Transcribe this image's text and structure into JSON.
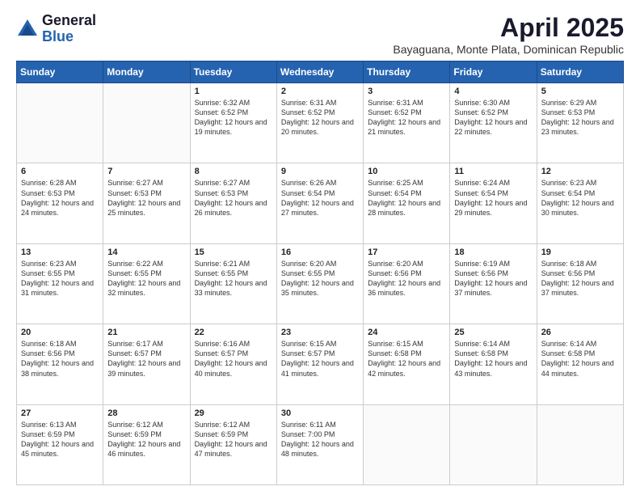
{
  "logo": {
    "general": "General",
    "blue": "Blue"
  },
  "header": {
    "month": "April 2025",
    "location": "Bayaguana, Monte Plata, Dominican Republic"
  },
  "days_of_week": [
    "Sunday",
    "Monday",
    "Tuesday",
    "Wednesday",
    "Thursday",
    "Friday",
    "Saturday"
  ],
  "weeks": [
    [
      {
        "day": "",
        "info": ""
      },
      {
        "day": "",
        "info": ""
      },
      {
        "day": "1",
        "info": "Sunrise: 6:32 AM\nSunset: 6:52 PM\nDaylight: 12 hours and 19 minutes."
      },
      {
        "day": "2",
        "info": "Sunrise: 6:31 AM\nSunset: 6:52 PM\nDaylight: 12 hours and 20 minutes."
      },
      {
        "day": "3",
        "info": "Sunrise: 6:31 AM\nSunset: 6:52 PM\nDaylight: 12 hours and 21 minutes."
      },
      {
        "day": "4",
        "info": "Sunrise: 6:30 AM\nSunset: 6:52 PM\nDaylight: 12 hours and 22 minutes."
      },
      {
        "day": "5",
        "info": "Sunrise: 6:29 AM\nSunset: 6:53 PM\nDaylight: 12 hours and 23 minutes."
      }
    ],
    [
      {
        "day": "6",
        "info": "Sunrise: 6:28 AM\nSunset: 6:53 PM\nDaylight: 12 hours and 24 minutes."
      },
      {
        "day": "7",
        "info": "Sunrise: 6:27 AM\nSunset: 6:53 PM\nDaylight: 12 hours and 25 minutes."
      },
      {
        "day": "8",
        "info": "Sunrise: 6:27 AM\nSunset: 6:53 PM\nDaylight: 12 hours and 26 minutes."
      },
      {
        "day": "9",
        "info": "Sunrise: 6:26 AM\nSunset: 6:54 PM\nDaylight: 12 hours and 27 minutes."
      },
      {
        "day": "10",
        "info": "Sunrise: 6:25 AM\nSunset: 6:54 PM\nDaylight: 12 hours and 28 minutes."
      },
      {
        "day": "11",
        "info": "Sunrise: 6:24 AM\nSunset: 6:54 PM\nDaylight: 12 hours and 29 minutes."
      },
      {
        "day": "12",
        "info": "Sunrise: 6:23 AM\nSunset: 6:54 PM\nDaylight: 12 hours and 30 minutes."
      }
    ],
    [
      {
        "day": "13",
        "info": "Sunrise: 6:23 AM\nSunset: 6:55 PM\nDaylight: 12 hours and 31 minutes."
      },
      {
        "day": "14",
        "info": "Sunrise: 6:22 AM\nSunset: 6:55 PM\nDaylight: 12 hours and 32 minutes."
      },
      {
        "day": "15",
        "info": "Sunrise: 6:21 AM\nSunset: 6:55 PM\nDaylight: 12 hours and 33 minutes."
      },
      {
        "day": "16",
        "info": "Sunrise: 6:20 AM\nSunset: 6:55 PM\nDaylight: 12 hours and 35 minutes."
      },
      {
        "day": "17",
        "info": "Sunrise: 6:20 AM\nSunset: 6:56 PM\nDaylight: 12 hours and 36 minutes."
      },
      {
        "day": "18",
        "info": "Sunrise: 6:19 AM\nSunset: 6:56 PM\nDaylight: 12 hours and 37 minutes."
      },
      {
        "day": "19",
        "info": "Sunrise: 6:18 AM\nSunset: 6:56 PM\nDaylight: 12 hours and 37 minutes."
      }
    ],
    [
      {
        "day": "20",
        "info": "Sunrise: 6:18 AM\nSunset: 6:56 PM\nDaylight: 12 hours and 38 minutes."
      },
      {
        "day": "21",
        "info": "Sunrise: 6:17 AM\nSunset: 6:57 PM\nDaylight: 12 hours and 39 minutes."
      },
      {
        "day": "22",
        "info": "Sunrise: 6:16 AM\nSunset: 6:57 PM\nDaylight: 12 hours and 40 minutes."
      },
      {
        "day": "23",
        "info": "Sunrise: 6:15 AM\nSunset: 6:57 PM\nDaylight: 12 hours and 41 minutes."
      },
      {
        "day": "24",
        "info": "Sunrise: 6:15 AM\nSunset: 6:58 PM\nDaylight: 12 hours and 42 minutes."
      },
      {
        "day": "25",
        "info": "Sunrise: 6:14 AM\nSunset: 6:58 PM\nDaylight: 12 hours and 43 minutes."
      },
      {
        "day": "26",
        "info": "Sunrise: 6:14 AM\nSunset: 6:58 PM\nDaylight: 12 hours and 44 minutes."
      }
    ],
    [
      {
        "day": "27",
        "info": "Sunrise: 6:13 AM\nSunset: 6:59 PM\nDaylight: 12 hours and 45 minutes."
      },
      {
        "day": "28",
        "info": "Sunrise: 6:12 AM\nSunset: 6:59 PM\nDaylight: 12 hours and 46 minutes."
      },
      {
        "day": "29",
        "info": "Sunrise: 6:12 AM\nSunset: 6:59 PM\nDaylight: 12 hours and 47 minutes."
      },
      {
        "day": "30",
        "info": "Sunrise: 6:11 AM\nSunset: 7:00 PM\nDaylight: 12 hours and 48 minutes."
      },
      {
        "day": "",
        "info": ""
      },
      {
        "day": "",
        "info": ""
      },
      {
        "day": "",
        "info": ""
      }
    ]
  ]
}
